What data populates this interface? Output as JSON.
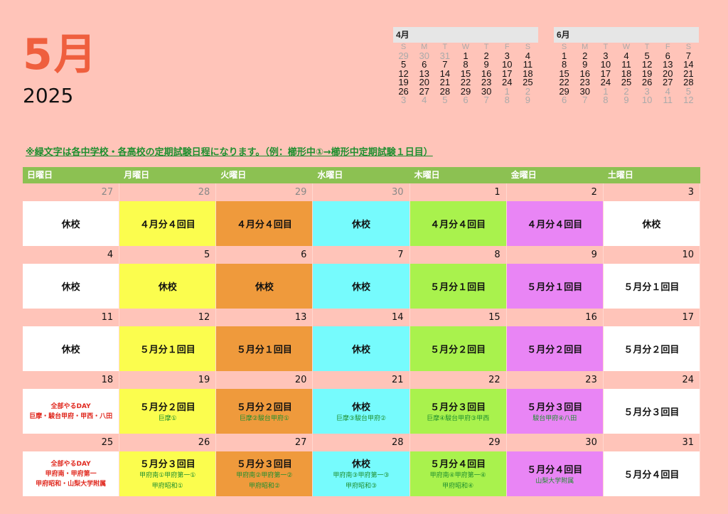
{
  "header": {
    "month": "5月",
    "year": "2025"
  },
  "mini_april": {
    "label": "4月",
    "dow": [
      "S",
      "M",
      "T",
      "W",
      "T",
      "F",
      "S"
    ],
    "rows": [
      [
        [
          "29",
          0
        ],
        [
          "30",
          0
        ],
        [
          "31",
          0
        ],
        [
          "1",
          1
        ],
        [
          "2",
          1
        ],
        [
          "3",
          1
        ],
        [
          "4",
          1
        ]
      ],
      [
        [
          "5",
          1
        ],
        [
          "6",
          1
        ],
        [
          "7",
          1
        ],
        [
          "8",
          1
        ],
        [
          "9",
          1
        ],
        [
          "10",
          1
        ],
        [
          "11",
          1
        ]
      ],
      [
        [
          "12",
          1
        ],
        [
          "13",
          1
        ],
        [
          "14",
          1
        ],
        [
          "15",
          1
        ],
        [
          "16",
          1
        ],
        [
          "17",
          1
        ],
        [
          "18",
          1
        ]
      ],
      [
        [
          "19",
          1
        ],
        [
          "20",
          1
        ],
        [
          "21",
          1
        ],
        [
          "22",
          1
        ],
        [
          "23",
          1
        ],
        [
          "24",
          1
        ],
        [
          "25",
          1
        ]
      ],
      [
        [
          "26",
          1
        ],
        [
          "27",
          1
        ],
        [
          "28",
          1
        ],
        [
          "29",
          1
        ],
        [
          "30",
          1
        ],
        [
          "1",
          0
        ],
        [
          "2",
          0
        ]
      ],
      [
        [
          "3",
          0
        ],
        [
          "4",
          0
        ],
        [
          "5",
          0
        ],
        [
          "6",
          0
        ],
        [
          "7",
          0
        ],
        [
          "8",
          0
        ],
        [
          "9",
          0
        ]
      ]
    ]
  },
  "mini_june": {
    "label": "6月",
    "dow": [
      "S",
      "M",
      "T",
      "W",
      "T",
      "F",
      "S"
    ],
    "rows": [
      [
        [
          "1",
          1
        ],
        [
          "2",
          1
        ],
        [
          "3",
          1
        ],
        [
          "4",
          1
        ],
        [
          "5",
          1
        ],
        [
          "6",
          1
        ],
        [
          "7",
          1
        ]
      ],
      [
        [
          "8",
          1
        ],
        [
          "9",
          1
        ],
        [
          "10",
          1
        ],
        [
          "11",
          1
        ],
        [
          "12",
          1
        ],
        [
          "13",
          1
        ],
        [
          "14",
          1
        ]
      ],
      [
        [
          "15",
          1
        ],
        [
          "16",
          1
        ],
        [
          "17",
          1
        ],
        [
          "18",
          1
        ],
        [
          "19",
          1
        ],
        [
          "20",
          1
        ],
        [
          "21",
          1
        ]
      ],
      [
        [
          "22",
          1
        ],
        [
          "23",
          1
        ],
        [
          "24",
          1
        ],
        [
          "25",
          1
        ],
        [
          "26",
          1
        ],
        [
          "27",
          1
        ],
        [
          "28",
          1
        ]
      ],
      [
        [
          "29",
          1
        ],
        [
          "30",
          1
        ],
        [
          "1",
          0
        ],
        [
          "2",
          0
        ],
        [
          "3",
          0
        ],
        [
          "4",
          0
        ],
        [
          "5",
          0
        ]
      ],
      [
        [
          "6",
          0
        ],
        [
          "7",
          0
        ],
        [
          "8",
          0
        ],
        [
          "9",
          0
        ],
        [
          "10",
          0
        ],
        [
          "11",
          0
        ],
        [
          "12",
          0
        ]
      ]
    ]
  },
  "note": "※緑文字は各中学校・各高校の定期試験日程になります。（例：櫛形中①→櫛形中定期試験１日目）",
  "weekdays": [
    "日曜日",
    "月曜日",
    "火曜日",
    "水曜日",
    "木曜日",
    "金曜日",
    "土曜日"
  ],
  "weeks": [
    {
      "days": [
        [
          "27",
          0
        ],
        [
          "28",
          0
        ],
        [
          "29",
          0
        ],
        [
          "30",
          0
        ],
        [
          "1",
          1
        ],
        [
          "2",
          1
        ],
        [
          "3",
          1
        ]
      ],
      "cells": [
        {
          "main": "休校",
          "subs": [],
          "reds": []
        },
        {
          "main": "４月分４回目",
          "subs": [],
          "reds": []
        },
        {
          "main": "４月分４回目",
          "subs": [],
          "reds": []
        },
        {
          "main": "休校",
          "subs": [],
          "reds": []
        },
        {
          "main": "４月分４回目",
          "subs": [],
          "reds": []
        },
        {
          "main": "４月分４回目",
          "subs": [],
          "reds": []
        },
        {
          "main": "休校",
          "subs": [],
          "reds": []
        }
      ]
    },
    {
      "days": [
        [
          "4",
          1
        ],
        [
          "5",
          1
        ],
        [
          "6",
          1
        ],
        [
          "7",
          1
        ],
        [
          "8",
          1
        ],
        [
          "9",
          1
        ],
        [
          "10",
          1
        ]
      ],
      "cells": [
        {
          "main": "休校",
          "subs": [],
          "reds": []
        },
        {
          "main": "休校",
          "subs": [],
          "reds": []
        },
        {
          "main": "休校",
          "subs": [],
          "reds": []
        },
        {
          "main": "休校",
          "subs": [],
          "reds": []
        },
        {
          "main": "５月分１回目",
          "subs": [],
          "reds": []
        },
        {
          "main": "５月分１回目",
          "subs": [],
          "reds": []
        },
        {
          "main": "５月分１回目",
          "subs": [],
          "reds": []
        }
      ]
    },
    {
      "days": [
        [
          "11",
          1
        ],
        [
          "12",
          1
        ],
        [
          "13",
          1
        ],
        [
          "14",
          1
        ],
        [
          "15",
          1
        ],
        [
          "16",
          1
        ],
        [
          "17",
          1
        ]
      ],
      "cells": [
        {
          "main": "休校",
          "subs": [],
          "reds": []
        },
        {
          "main": "５月分１回目",
          "subs": [],
          "reds": []
        },
        {
          "main": "５月分１回目",
          "subs": [],
          "reds": []
        },
        {
          "main": "休校",
          "subs": [],
          "reds": []
        },
        {
          "main": "５月分２回目",
          "subs": [],
          "reds": []
        },
        {
          "main": "５月分２回目",
          "subs": [],
          "reds": []
        },
        {
          "main": "５月分２回目",
          "subs": [],
          "reds": []
        }
      ]
    },
    {
      "days": [
        [
          "18",
          1
        ],
        [
          "19",
          1
        ],
        [
          "20",
          1
        ],
        [
          "21",
          1
        ],
        [
          "22",
          1
        ],
        [
          "23",
          1
        ],
        [
          "24",
          1
        ]
      ],
      "cells": [
        {
          "main": "",
          "subs": [],
          "reds": [
            "全部やるDAY",
            "巨摩・駿台甲府・甲西・八田"
          ]
        },
        {
          "main": "５月分２回目",
          "subs": [
            "巨摩①"
          ],
          "reds": []
        },
        {
          "main": "５月分２回目",
          "subs": [
            "巨摩②駿台甲府①"
          ],
          "reds": []
        },
        {
          "main": "休校",
          "subs": [
            "巨摩③駿台甲府②"
          ],
          "reds": []
        },
        {
          "main": "５月分３回目",
          "subs": [
            "巨摩④駿台甲府③甲西"
          ],
          "reds": []
        },
        {
          "main": "５月分３回目",
          "subs": [
            "駿台甲府④八田"
          ],
          "reds": []
        },
        {
          "main": "５月分３回目",
          "subs": [],
          "reds": []
        }
      ]
    },
    {
      "days": [
        [
          "25",
          1
        ],
        [
          "26",
          1
        ],
        [
          "27",
          1
        ],
        [
          "28",
          1
        ],
        [
          "29",
          1
        ],
        [
          "30",
          1
        ],
        [
          "31",
          1
        ]
      ],
      "cells": [
        {
          "main": "",
          "subs": [],
          "reds": [
            "全部やるDAY",
            "甲府南・甲府第一",
            "甲府昭和・山梨大学附属"
          ]
        },
        {
          "main": "５月分３回目",
          "subs": [
            "甲府南①甲府第一①",
            "甲府昭和①"
          ],
          "reds": []
        },
        {
          "main": "５月分３回目",
          "subs": [
            "甲府南②甲府第一②",
            "甲府昭和②"
          ],
          "reds": []
        },
        {
          "main": "休校",
          "subs": [
            "甲府南③甲府第一③",
            "甲府昭和③"
          ],
          "reds": []
        },
        {
          "main": "５月分４回目",
          "subs": [
            "甲府南④甲府第一④",
            "甲府昭和④"
          ],
          "reds": []
        },
        {
          "main": "５月分４回目",
          "subs": [
            "山梨大学附属"
          ],
          "reds": []
        },
        {
          "main": "５月分４回目",
          "subs": [],
          "reds": []
        }
      ]
    }
  ]
}
